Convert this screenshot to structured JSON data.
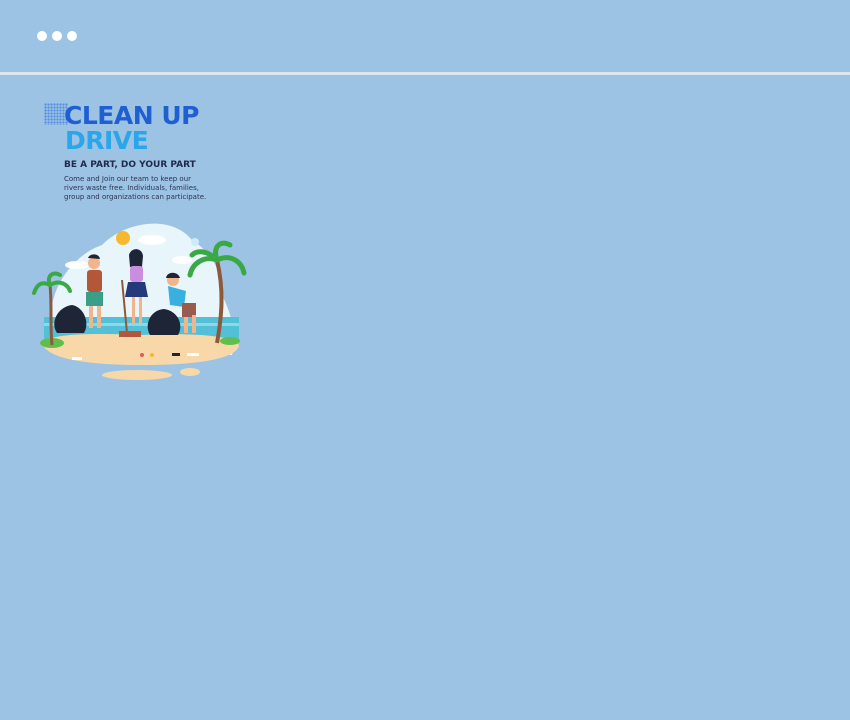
{
  "window": {
    "controls": [
      "dot-icon",
      "dot-icon",
      "dot-icon"
    ]
  },
  "flyer": {
    "title_line1": "CLEAN UP",
    "title_line2": "DRIVE",
    "tagline": "BE A PART, DO YOUR PART",
    "description": "Come and Join our team to keep our rivers waste free. Individuals, families, group and organizations can participate.",
    "colors": {
      "title_primary": "#1f5fd1",
      "title_secondary": "#2aa6ea",
      "background": "#9dc3e4"
    }
  }
}
